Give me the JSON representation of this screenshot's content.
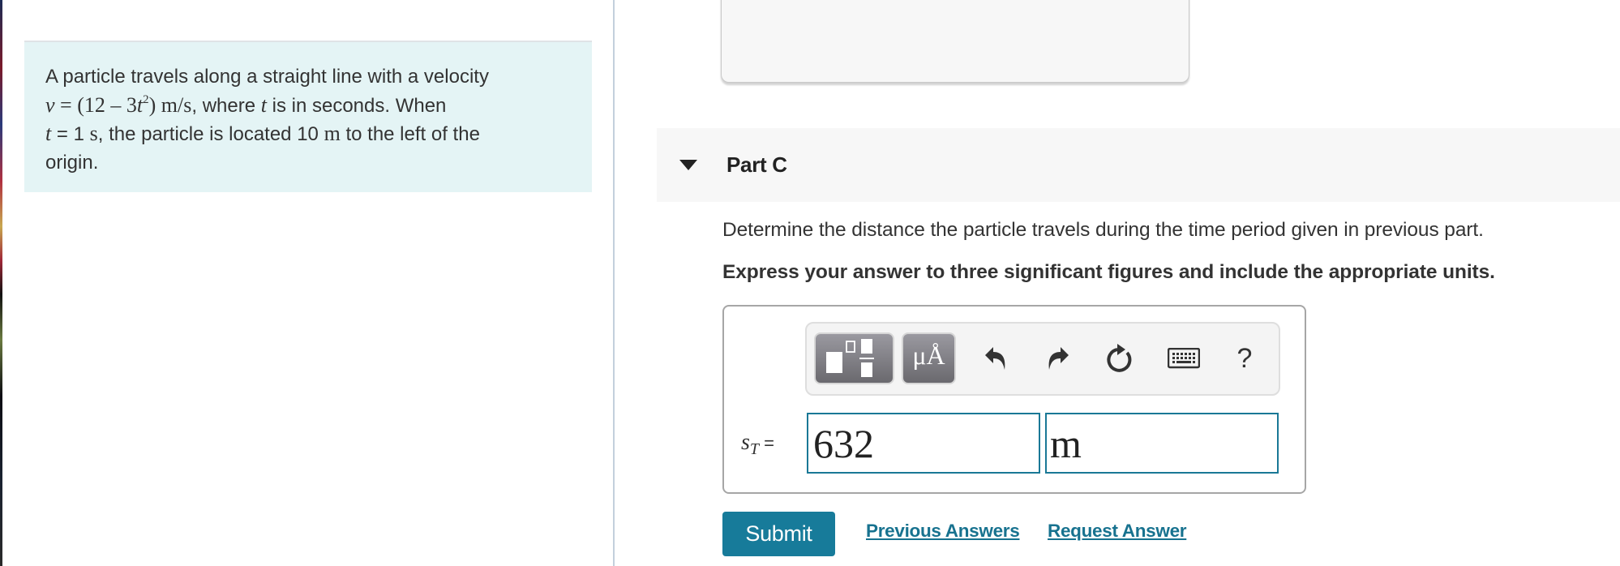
{
  "problem": {
    "line1": "A particle travels along a straight line with a velocity",
    "velocity_var": "v",
    "velocity_eq_prefix": " = (12 – 3",
    "velocity_t": "t",
    "velocity_exp": "2",
    "velocity_close": ")",
    "velocity_units": " m/s",
    "line2_rest_a": ", where ",
    "line2_t": "t",
    "line2_rest_b": " is in seconds. When",
    "line3_t": "t",
    "line3_a": " = 1 ",
    "line3_s": "s",
    "line3_b": ", the particle is located 10 ",
    "line3_m": "m",
    "line3_c": " to the left of the",
    "line4": "origin."
  },
  "part": {
    "title": "Part C",
    "question": "Determine the distance the particle travels during the time period given in previous part.",
    "instructions": "Express your answer to three significant figures and include the appropriate units."
  },
  "toolbar": {
    "units_label": "μÅ",
    "help_label": "?",
    "icons": [
      "templates-icon",
      "units-icon",
      "undo-icon",
      "redo-icon",
      "reset-icon",
      "keyboard-icon",
      "help-icon"
    ]
  },
  "answer": {
    "var_symbol": "s",
    "var_subscript": "T",
    "equals": " =",
    "value": "632",
    "unit": "m"
  },
  "actions": {
    "submit_label": "Submit",
    "previous_answers_label": "Previous Answers",
    "request_answer_label": "Request Answer"
  },
  "colors": {
    "problem_bg": "#e4f4f5",
    "accent": "#177b9a",
    "link": "#17728f",
    "input_border": "#1a7896"
  }
}
